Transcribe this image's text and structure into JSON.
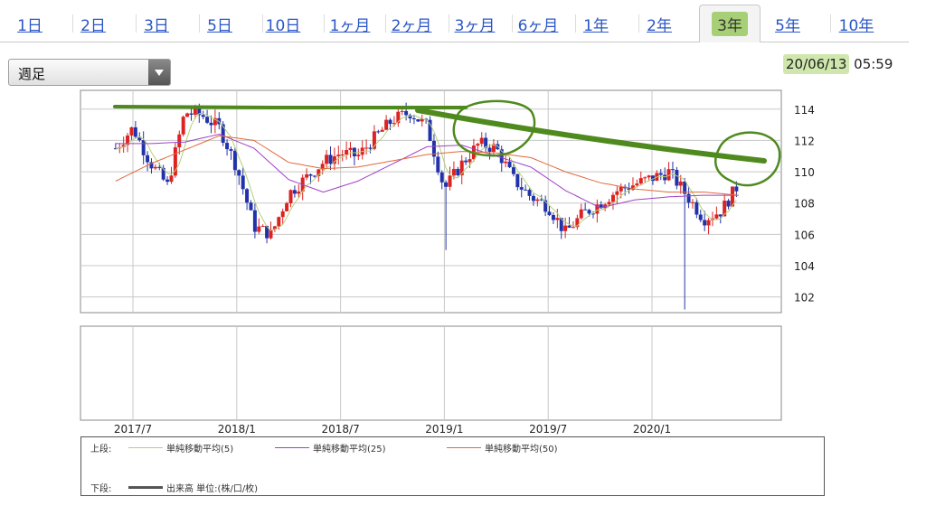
{
  "tabs": [
    {
      "label": "1日",
      "active": false
    },
    {
      "label": "2日",
      "active": false
    },
    {
      "label": "3日",
      "active": false
    },
    {
      "label": "5日",
      "active": false
    },
    {
      "label": "10日",
      "active": false
    },
    {
      "label": "1ヶ月",
      "active": false
    },
    {
      "label": "2ヶ月",
      "active": false
    },
    {
      "label": "3ヶ月",
      "active": false
    },
    {
      "label": "6ヶ月",
      "active": false
    },
    {
      "label": "1年",
      "active": false
    },
    {
      "label": "2年",
      "active": false
    },
    {
      "label": "3年",
      "active": true
    },
    {
      "label": "5年",
      "active": false
    },
    {
      "label": "10年",
      "active": false
    }
  ],
  "period_select": {
    "value": "週足"
  },
  "timestamp": {
    "date": "20/06/13",
    "time": "05:59"
  },
  "legend": {
    "upper_label": "上段:",
    "lower_label": "下段:",
    "ma5": "単純移動平均(5)",
    "ma25": "単純移動平均(25)",
    "ma50": "単純移動平均(50)",
    "volume": "出来高 単位:(株/口/枚)"
  },
  "colors": {
    "up": "#dd2222",
    "down": "#2233aa",
    "ma5": "#b4d07c",
    "ma25": "#a040c8",
    "ma50": "#e06a3c",
    "annotation": "#4f8a1e",
    "grid": "#c8c8c8"
  },
  "chart_data": {
    "type": "candlestick",
    "y_ticks": [
      102,
      104,
      106,
      108,
      110,
      112,
      114
    ],
    "ylim": [
      101,
      115.2
    ],
    "x_tick_labels": [
      "2017/7",
      "2018/1",
      "2018/7",
      "2019/1",
      "2019/7",
      "2020/1"
    ],
    "x_ticks_at": [
      "2017/7",
      "2018/1",
      "2018/7",
      "2019/1",
      "2019/7",
      "2020/1"
    ],
    "x_range": [
      "2017/6",
      "2020/6"
    ],
    "grid": true,
    "close_series": {
      "x": [
        "2017/6",
        "2017/7",
        "2017/8",
        "2017/9",
        "2017/10",
        "2017/11",
        "2017/12",
        "2018/1",
        "2018/2",
        "2018/3",
        "2018/4",
        "2018/5",
        "2018/6",
        "2018/7",
        "2018/8",
        "2018/9",
        "2018/10",
        "2018/11",
        "2018/12",
        "2019/1",
        "2019/2",
        "2019/3",
        "2019/4",
        "2019/5",
        "2019/6",
        "2019/7",
        "2019/8",
        "2019/9",
        "2019/10",
        "2019/11",
        "2019/12",
        "2020/1",
        "2020/2",
        "2020/3",
        "2020/4",
        "2020/5",
        "2020/6"
      ],
      "y": [
        111.5,
        112.8,
        110.6,
        109.1,
        113.8,
        113.6,
        112.8,
        110.3,
        106.5,
        106.0,
        108.6,
        109.6,
        110.6,
        111.2,
        111.0,
        112.2,
        113.3,
        113.8,
        112.9,
        108.9,
        110.5,
        111.8,
        111.5,
        109.5,
        108.4,
        107.8,
        106.1,
        107.3,
        108.0,
        108.8,
        109.2,
        109.6,
        110.0,
        108.5,
        107.0,
        107.5,
        109.2
      ]
    },
    "ma25": {
      "x": [
        "2017/6",
        "2017/8",
        "2017/10",
        "2017/12",
        "2018/2",
        "2018/4",
        "2018/6",
        "2018/8",
        "2018/10",
        "2018/12",
        "2019/2",
        "2019/4",
        "2019/6",
        "2019/8",
        "2019/10",
        "2019/12",
        "2020/2",
        "2020/4",
        "2020/6"
      ],
      "y": [
        111.8,
        111.8,
        111.9,
        112.4,
        111.5,
        109.5,
        108.7,
        109.4,
        110.5,
        111.6,
        111.7,
        111.0,
        110.3,
        108.8,
        107.7,
        108.2,
        108.4,
        108.5,
        108.5
      ]
    },
    "ma50": {
      "x": [
        "2017/6",
        "2017/8",
        "2017/10",
        "2017/12",
        "2018/2",
        "2018/4",
        "2018/6",
        "2018/8",
        "2018/10",
        "2018/12",
        "2019/2",
        "2019/4",
        "2019/6",
        "2019/8",
        "2019/10",
        "2019/12",
        "2020/2",
        "2020/4",
        "2020/6"
      ],
      "y": [
        109.4,
        110.5,
        111.4,
        112.3,
        112.0,
        110.6,
        110.2,
        110.3,
        110.7,
        111.1,
        111.3,
        111.2,
        110.9,
        110.0,
        109.3,
        108.9,
        108.7,
        108.7,
        108.5
      ]
    },
    "notable_wicks": [
      {
        "x": "2019/1",
        "low": 105.0
      },
      {
        "x": "2020/3",
        "low": 101.2
      }
    ]
  }
}
